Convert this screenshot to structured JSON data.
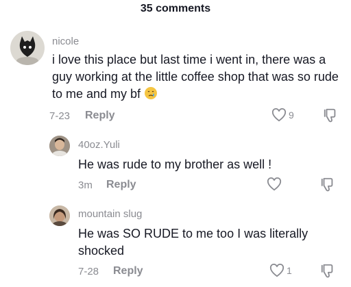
{
  "header": {
    "title": "35 comments"
  },
  "comments": [
    {
      "username": "nicole",
      "text": "i love this place but last time i went in, there was a guy working at the little coffee shop that was so rude to me and my bf",
      "emoji": "crying-face-icon",
      "date": "7-23",
      "reply_label": "Reply",
      "likes": "9"
    },
    {
      "username": "40oz.Yuli",
      "text": "He was rude to my brother as well !",
      "date": "3m",
      "reply_label": "Reply",
      "likes": ""
    },
    {
      "username": "mountain slug",
      "text": "He was SO RUDE to me too I was literally shocked",
      "date": "7-28",
      "reply_label": "Reply",
      "likes": "1"
    }
  ],
  "colors": {
    "text": "#161823",
    "muted": "#8a8b91",
    "emoji": "#f5c542"
  }
}
